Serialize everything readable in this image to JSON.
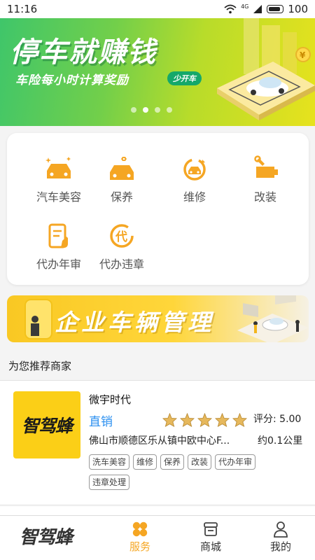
{
  "status_bar": {
    "time": "11:16",
    "network": "4G",
    "battery": "100"
  },
  "banner": {
    "title": "停车就赚钱",
    "subtitle": "车险每小时计算奖励",
    "pill": "少开车",
    "slide_count": 4,
    "active_slide": 1
  },
  "services": [
    {
      "label": "汽车美容",
      "icon": "car-wash-icon"
    },
    {
      "label": "保养",
      "icon": "car-maintenance-icon"
    },
    {
      "label": "维修",
      "icon": "repair-icon"
    },
    {
      "label": "改装",
      "icon": "modification-icon"
    },
    {
      "label": "代办年审",
      "icon": "annual-inspection-icon"
    },
    {
      "label": "代办违章",
      "icon": "violation-icon"
    }
  ],
  "enterprise_banner": {
    "title": "企业车辆管理"
  },
  "recommend": {
    "section_title": "为您推荐商家",
    "merchants": [
      {
        "logo_text": "智驾蜂",
        "name": "微宇时代",
        "tag": "直销",
        "rating": 5,
        "score_label": "评分: 5.00",
        "address": "佛山市顺德区乐从镇中欧中心F...",
        "distance": "约0.1公里",
        "service_tags": [
          "洗车美容",
          "维修",
          "保养",
          "改装",
          "代办年审",
          "违章处理"
        ]
      }
    ]
  },
  "bottom_nav": {
    "logo": "智驾蜂",
    "items": [
      {
        "label": "服务",
        "active": true
      },
      {
        "label": "商城",
        "active": false
      },
      {
        "label": "我的",
        "active": false
      }
    ]
  },
  "colors": {
    "accent": "#f5a623",
    "link_blue": "#2a8ff0",
    "star": "#e6b85c"
  }
}
